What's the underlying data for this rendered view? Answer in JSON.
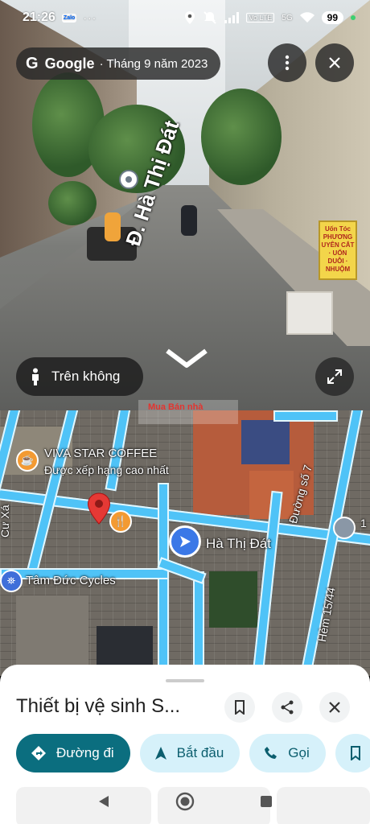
{
  "status_bar": {
    "time": "21:26",
    "app_badge": "Zalo",
    "more": "···",
    "network_label": "Vo LTE",
    "signal_label": "5G",
    "battery": "99"
  },
  "street_view": {
    "brand": "Google",
    "date_text": "· Tháng 9 năm 2023",
    "street_label": "Đ. Hà Thị Đát",
    "aerial_button_label": "Trên không",
    "shop_sign_text": "Uốn Tóc PHƯƠNG UYÊN CẮT · UỐN DUỖI · NHUỘM"
  },
  "map": {
    "poi_coffee_name": "VIVA STAR COFFEE",
    "poi_coffee_sub": "Được xếp hạng cao nhất",
    "street_main": "Hà Thị Đát",
    "street_side": "Đường số 7",
    "alley": "Hẻm 15/44",
    "poi_cycles": "Tâm Đức Cycles",
    "left_street_fragment": "Cư Xá",
    "right_edge_fragment": "1",
    "watermark": "Mua Bán nhà"
  },
  "sheet": {
    "title": "Thiết bị vệ sinh S...",
    "actions": [
      {
        "label": "Đường đi"
      },
      {
        "label": "Bắt đầu"
      },
      {
        "label": "Gọi"
      }
    ]
  },
  "colors": {
    "primary": "#0b6e7f",
    "secondary": "#d6f1fa",
    "road_highlight": "#4fc3f7",
    "pin": "#e53935",
    "nav_blue": "#3b78e7"
  }
}
